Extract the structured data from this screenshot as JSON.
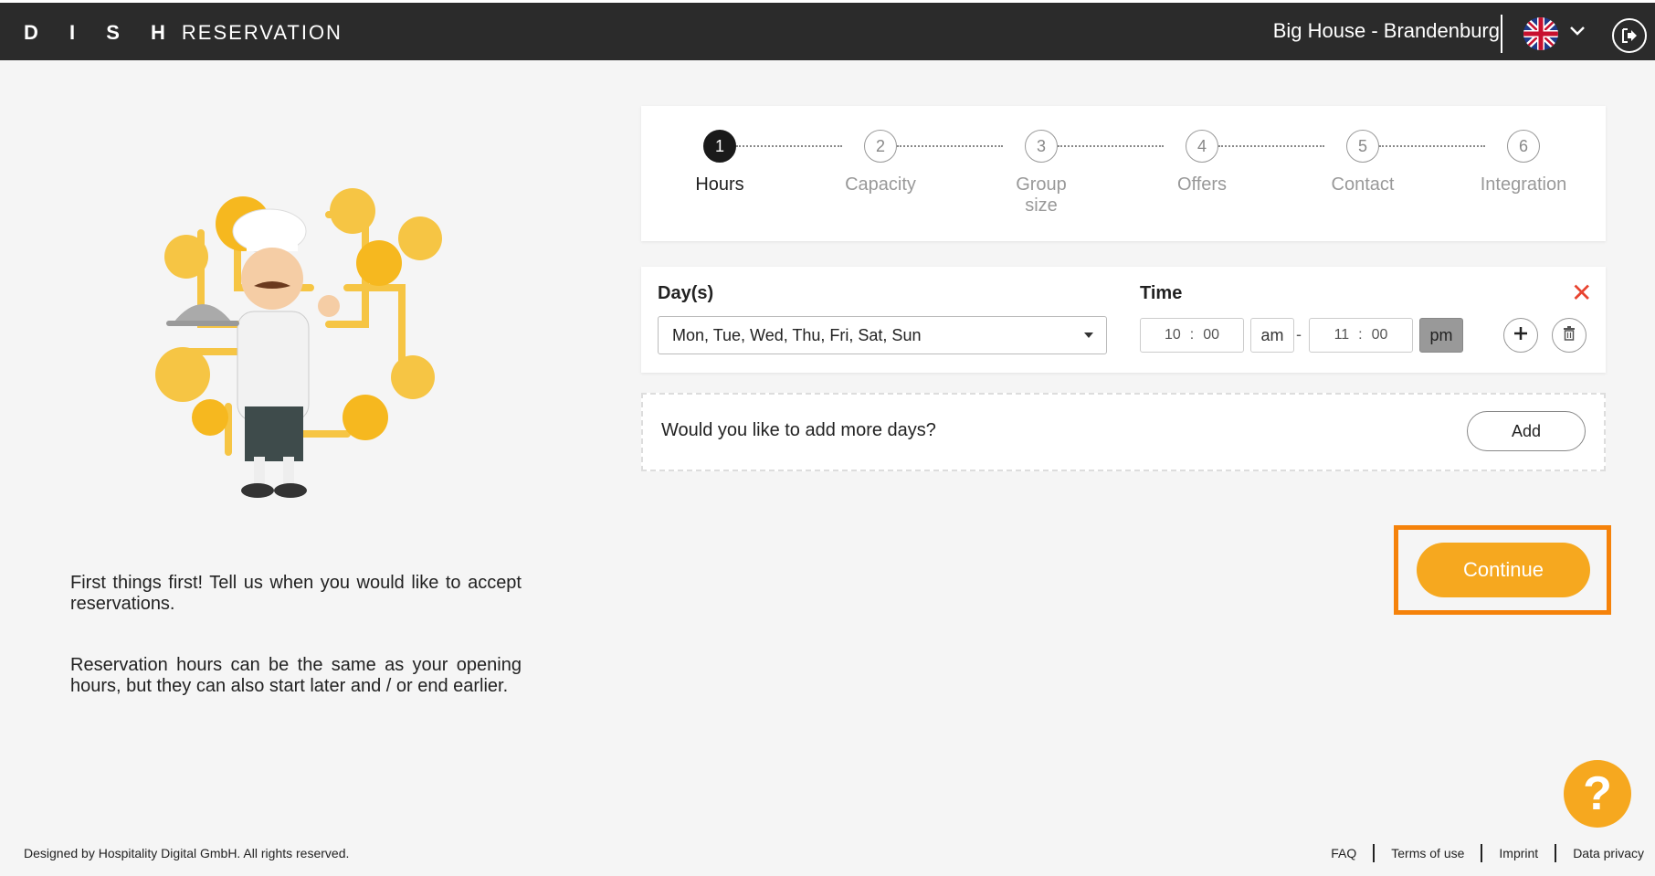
{
  "header": {
    "logo_bold": "D I S H",
    "logo_light": "RESERVATION",
    "venue": "Big House - Brandenburg",
    "language_icon": "uk-flag-icon",
    "chevron_icon": "chevron-down-icon",
    "logout_icon": "logout-icon"
  },
  "intro": {
    "p1": "First things first! Tell us when you would like to accept reservations.",
    "p2": "Reservation hours can be the same as your opening hours, but they can also start later and / or end earlier."
  },
  "steps": [
    {
      "num": "1",
      "label": "Hours"
    },
    {
      "num": "2",
      "label": "Capacity"
    },
    {
      "num": "3",
      "label": "Group size"
    },
    {
      "num": "4",
      "label": "Offers"
    },
    {
      "num": "5",
      "label": "Contact"
    },
    {
      "num": "6",
      "label": "Integration"
    }
  ],
  "hours": {
    "days_label": "Day(s)",
    "time_label": "Time",
    "days_value": "Mon, Tue, Wed, Thu, Fri, Sat, Sun",
    "start_hour": "10",
    "start_min": "00",
    "start_ampm": "am",
    "end_hour": "11",
    "end_min": "00",
    "end_ampm": "pm",
    "colon": ":",
    "dash": "-",
    "close": "✕"
  },
  "add_more": {
    "question": "Would you like to add more days?",
    "button": "Add"
  },
  "continue_label": "Continue",
  "help_label": "?",
  "footer": {
    "copyright": "Designed by Hospitality Digital GmbH. All rights reserved.",
    "links": [
      "FAQ",
      "Terms of use",
      "Imprint",
      "Data privacy"
    ]
  },
  "colors": {
    "accent": "#f6a81f",
    "highlight": "#f5820a",
    "topbar": "#2b2b2b",
    "danger": "#e8432f"
  }
}
